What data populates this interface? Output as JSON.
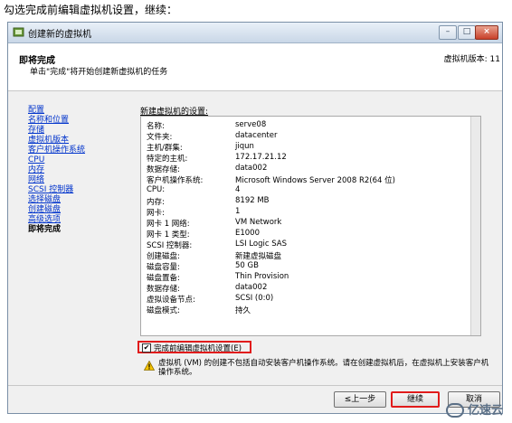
{
  "caption": "勾选完成前编辑虚拟机设置，继续：",
  "window": {
    "title": "创建新的虚拟机",
    "buttons": {
      "minimize": "–",
      "maximize": "□",
      "close": "×"
    }
  },
  "header": {
    "title": "即将完成",
    "subtitle": "单击\"完成\"将开始创建新虚拟机的任务",
    "version": "虚拟机版本: 11"
  },
  "nav": {
    "items": [
      "配置",
      "名称和位置",
      "存储",
      "虚拟机版本",
      "客户机操作系统",
      "CPU",
      "内存",
      "网络",
      "SCSI 控制器",
      "选择磁盘",
      "创建磁盘",
      "高级选项",
      "即将完成"
    ],
    "current": "即将完成"
  },
  "settings": {
    "title": "新建虚拟机的设置:",
    "rows": [
      {
        "label": "名称:",
        "value": "serve08"
      },
      {
        "label": "文件夹:",
        "value": "datacenter"
      },
      {
        "label": "主机/群集:",
        "value": "jiqun"
      },
      {
        "label": "特定的主机:",
        "value": "172.17.21.12"
      },
      {
        "label": "数据存储:",
        "value": "data002"
      },
      {
        "label": "客户机操作系统:",
        "value": "Microsoft Windows Server 2008 R2(64 位)"
      },
      {
        "label": "CPU:",
        "value": "4"
      },
      {
        "label": "内存:",
        "value": "8192 MB"
      },
      {
        "label": "网卡:",
        "value": "1"
      },
      {
        "label": "网卡 1 网络:",
        "value": "VM Network"
      },
      {
        "label": "网卡 1 类型:",
        "value": "E1000"
      },
      {
        "label": "SCSI 控制器:",
        "value": "LSI Logic SAS"
      },
      {
        "label": "创建磁盘:",
        "value": "新建虚拟磁盘"
      },
      {
        "label": "磁盘容量:",
        "value": "50 GB"
      },
      {
        "label": "磁盘置备:",
        "value": "Thin Provision"
      },
      {
        "label": "数据存储:",
        "value": "data002"
      },
      {
        "label": "虚拟设备节点:",
        "value": "SCSI (0:0)"
      },
      {
        "label": "磁盘模式:",
        "value": "持久"
      }
    ]
  },
  "edit_option": {
    "label": "完成前编辑虚拟机设置(E)",
    "checked": true,
    "mark": "✔"
  },
  "warning": {
    "icon": "warning-icon",
    "text": "虚拟机 (VM) 的创建不包括自动安装客户机操作系统。请在创建虚拟机后，在虚拟机上安装客户机操作系统。"
  },
  "buttons": {
    "back": "≤上一步",
    "next": "继续",
    "cancel": "取消"
  },
  "watermark": "亿速云"
}
